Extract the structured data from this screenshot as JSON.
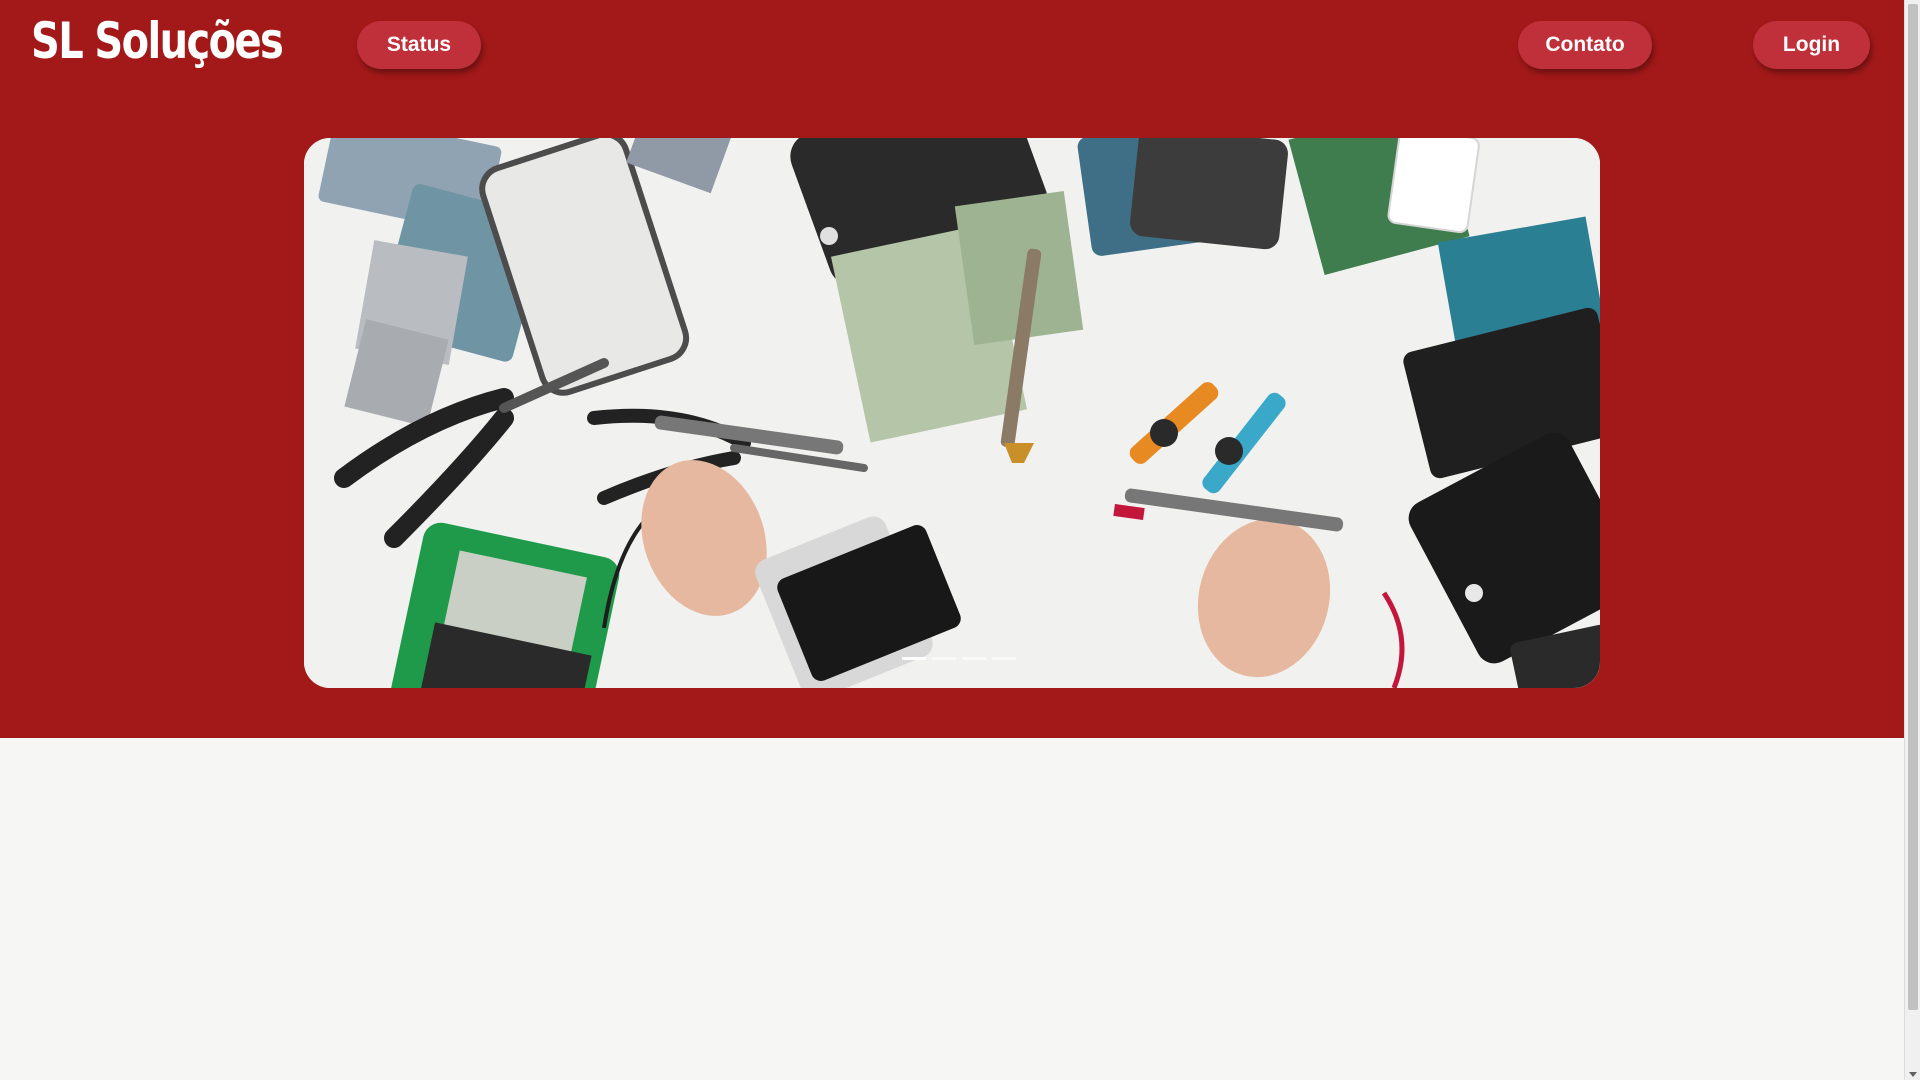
{
  "header": {
    "logo_text": "SL Soluções",
    "nav": {
      "status_label": "Status",
      "contato_label": "Contato",
      "login_label": "Login"
    }
  },
  "hero": {
    "slide_count": 4,
    "active_slide": 1
  },
  "colors": {
    "header_bg": "#a31919",
    "button_bg": "#c0303a",
    "page_bg": "#f6f6f4"
  }
}
